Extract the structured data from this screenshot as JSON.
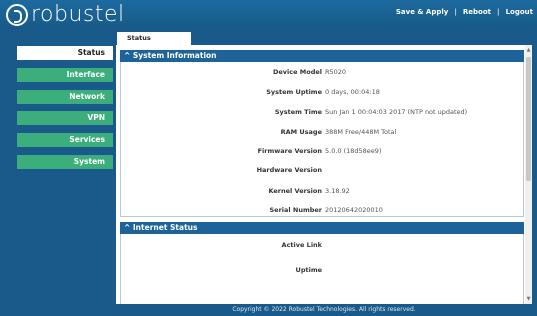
{
  "brand": {
    "logo_text": "robustel"
  },
  "header": {
    "save_apply": "Save & Apply",
    "reboot": "Reboot",
    "logout": "Logout"
  },
  "sidebar": {
    "items": [
      {
        "label": "Status"
      },
      {
        "label": "Interface"
      },
      {
        "label": "Network"
      },
      {
        "label": "VPN"
      },
      {
        "label": "Services"
      },
      {
        "label": "System"
      }
    ]
  },
  "tab": {
    "label": "Status"
  },
  "system_information": {
    "title": "^ System Information",
    "rows": [
      {
        "label": "Device Model",
        "value": "R5020"
      },
      {
        "label": "System Uptime",
        "value": "0 days, 00:04:18"
      },
      {
        "label": "System Time",
        "value": "Sun Jan 1 00:04:03 2017 (NTP not updated)"
      },
      {
        "label": "RAM Usage",
        "value": "388M Free/448M Total"
      },
      {
        "label": "Firmware Version",
        "value": "5.0.0 (18d58ee9)"
      },
      {
        "label": "Hardware Version",
        "value": ""
      },
      {
        "label": "Kernel Version",
        "value": "3.18.92"
      },
      {
        "label": "Serial Number",
        "value": "20120642020010"
      }
    ]
  },
  "internet_status": {
    "title": "^ Internet Status",
    "rows": [
      {
        "label": "Active Link",
        "value": ""
      },
      {
        "label": "Uptime",
        "value": ""
      }
    ]
  },
  "scroll": {
    "up_arrow": "▲",
    "down_arrow": "▼"
  },
  "footer": {
    "text": "Copyright © 2022 Robustel Technologies. All rights reserved."
  }
}
